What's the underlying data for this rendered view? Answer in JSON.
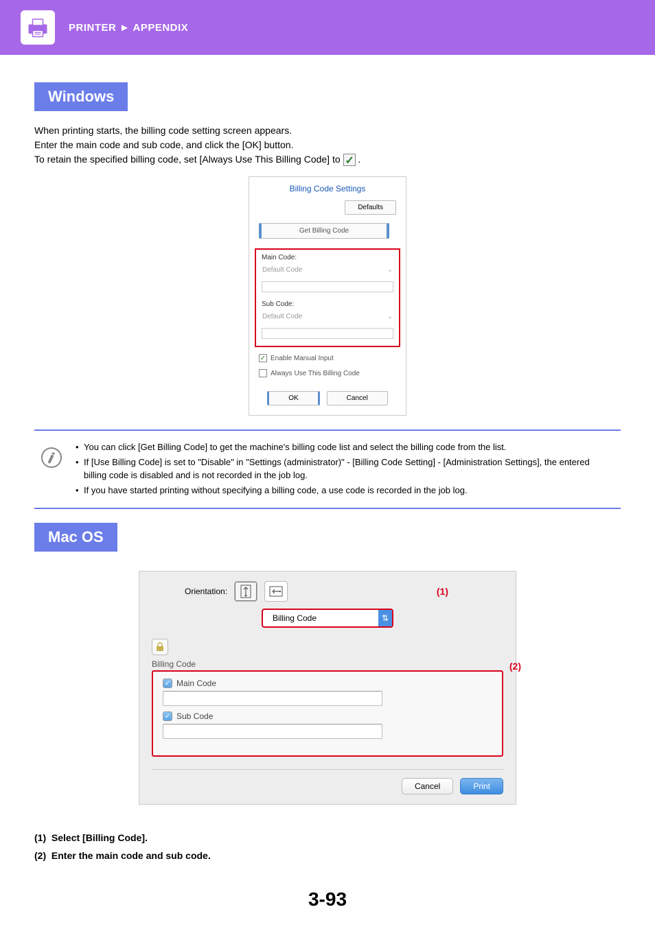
{
  "header": {
    "breadcrumb_left": "PRINTER",
    "breadcrumb_sep": "►",
    "breadcrumb_right": "APPENDIX"
  },
  "windows": {
    "heading": "Windows",
    "para1": "When printing starts, the billing code setting screen appears.",
    "para2": "Enter the main code and sub code, and click the [OK] button.",
    "para3a": "To retain the specified billing code, set [Always Use This Billing Code] to ",
    "para3b": ".",
    "dialog": {
      "title": "Billing Code Settings",
      "defaults_btn": "Defaults",
      "get_btn": "Get Billing Code",
      "main_label": "Main Code:",
      "main_value": "Default Code",
      "sub_label": "Sub Code:",
      "sub_value": "Default Code",
      "enable_manual": "Enable Manual Input",
      "always_use": "Always Use This Billing Code",
      "ok": "OK",
      "cancel": "Cancel"
    }
  },
  "notes": {
    "n1": "You can click [Get Billing Code] to get the machine's billing code list and select the billing code from the list.",
    "n2": "If [Use Billing Code] is set to \"Disable\" in \"Settings (administrator)\" - [Billing Code Setting] - [Administration Settings], the entered billing code is disabled and is not recorded in the job log.",
    "n3": "If you have started printing without specifying a billing code, a use code is recorded in the job log."
  },
  "mac": {
    "heading": "Mac OS",
    "orientation_label": "Orientation:",
    "select_value": "Billing Code",
    "callout1": "(1)",
    "callout2": "(2)",
    "panel_label": "Billing Code",
    "main_code": "Main Code",
    "sub_code": "Sub Code",
    "cancel": "Cancel",
    "print": "Print"
  },
  "steps": {
    "s1_num": "(1)",
    "s1_text": "Select [Billing Code].",
    "s2_num": "(2)",
    "s2_text": "Enter the main code and sub code."
  },
  "page_number": "3-93"
}
